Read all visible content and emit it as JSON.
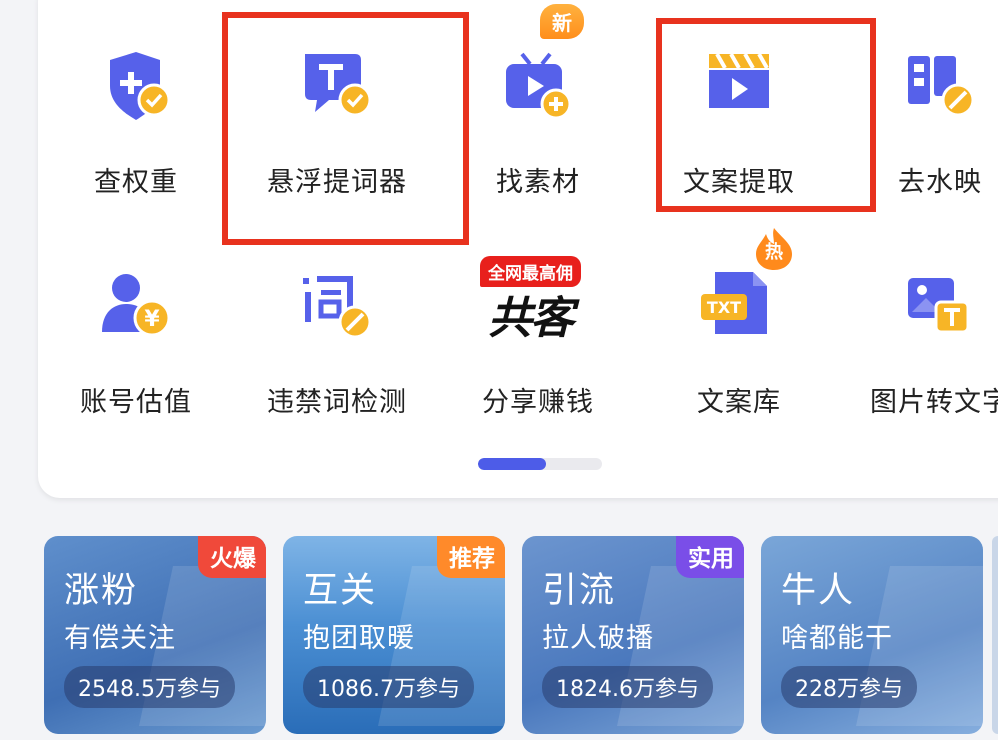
{
  "tools": [
    {
      "label": "查权重",
      "icon": "shield-plus-icon"
    },
    {
      "label": "悬浮提词器",
      "icon": "teleprompter-icon"
    },
    {
      "label": "找素材",
      "icon": "tv-plus-icon"
    },
    {
      "label": "文案提取",
      "icon": "clapperboard-icon"
    },
    {
      "label": "去水映",
      "icon": "stamp-erase-icon"
    },
    {
      "label": "账号估值",
      "icon": "user-yen-icon"
    },
    {
      "label": "违禁词检测",
      "icon": "word-check-icon"
    },
    {
      "label": "分享赚钱",
      "icon": "share-earn-icon"
    },
    {
      "label": "文案库",
      "icon": "txt-file-icon"
    },
    {
      "label": "图片转文字",
      "icon": "image-to-text-icon"
    }
  ],
  "badges": {
    "new": "新",
    "hot": "热",
    "promo": "全网最高佣",
    "share_logo": "共客"
  },
  "pager_progress": 0.55,
  "events": [
    {
      "title": "涨粉",
      "subtitle": "有偿关注",
      "count": "2548.5万参与",
      "tag": "火爆",
      "tag_color": "#f0493a"
    },
    {
      "title": "互关",
      "subtitle": "抱团取暖",
      "count": "1086.7万参与",
      "tag": "推荐",
      "tag_color": "#ff8a2a"
    },
    {
      "title": "引流",
      "subtitle": "拉人破播",
      "count": "1824.6万参与",
      "tag": "实用",
      "tag_color": "#7a4ee8"
    },
    {
      "title": "牛人",
      "subtitle": "啥都能干",
      "count": "228万参与",
      "tag": "",
      "tag_color": ""
    }
  ],
  "colors": {
    "accent": "#4d5ce8",
    "icon_primary": "#5661ea",
    "icon_check": "#f7b526",
    "highlight": "#e8321e"
  }
}
